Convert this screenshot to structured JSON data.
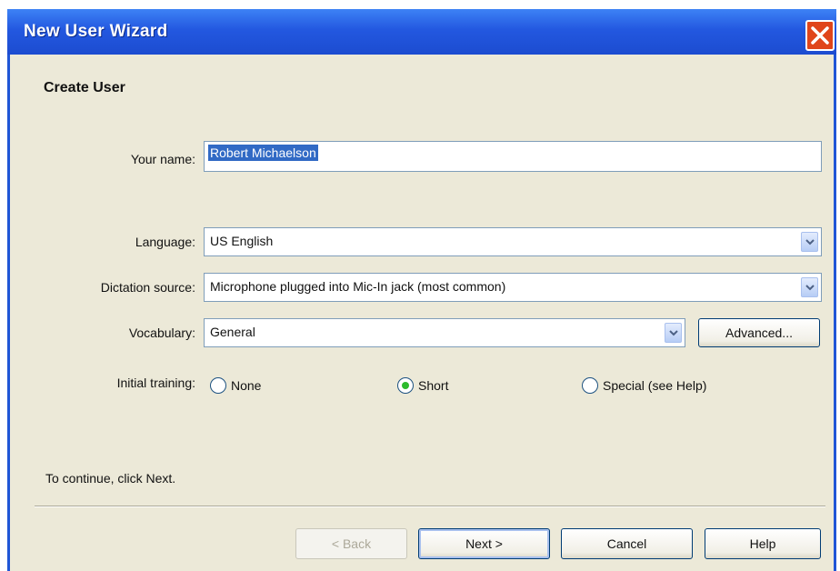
{
  "window": {
    "title": "New User Wizard"
  },
  "section_title": "Create User",
  "fields": {
    "name_label": "Your name:",
    "name_value": "Robert Michaelson",
    "language_label": "Language:",
    "language_value": "US English",
    "dictation_label": "Dictation source:",
    "dictation_value": "Microphone plugged into Mic-In jack (most common)",
    "vocabulary_label": "Vocabulary:",
    "vocabulary_value": "General",
    "advanced_button": "Advanced..."
  },
  "training": {
    "label": "Initial training:",
    "options": [
      {
        "label": "None",
        "selected": false
      },
      {
        "label": "Short",
        "selected": true
      },
      {
        "label": "Special (see Help)",
        "selected": false
      }
    ]
  },
  "footer": {
    "continue_text": "To continue, click Next.",
    "back_label": "< Back",
    "next_label": "Next >",
    "cancel_label": "Cancel",
    "help_label": "Help"
  },
  "colors": {
    "titlebar": "#2358e0",
    "selection": "#316ac5",
    "radio_dot": "#2dbb2d",
    "close": "#e0451b"
  },
  "icons": {
    "close": "close-icon",
    "dropdown": "chevron-down-icon"
  }
}
